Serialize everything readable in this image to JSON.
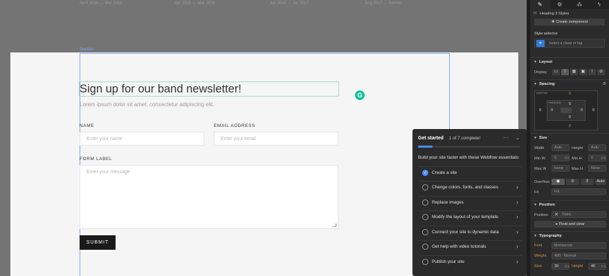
{
  "canvas": {
    "timeline": [
      "April 2014 — Mar 2015",
      "Apr 2015 — Mar 2016",
      "Jun 2016 — Jul 2017",
      "Aug 2017 — forever"
    ],
    "selection_tag": "Section",
    "heading": "Sign up for our band newsletter!",
    "subtitle": "Lorem ipsum dolor sit amet, consectetur adipiscing elit.",
    "form": {
      "name_label": "NAME",
      "name_placeholder": "Enter your name",
      "email_label": "EMAIL ADDRESS",
      "email_placeholder": "Enter your email",
      "message_label": "FORM LABEL",
      "message_placeholder": "Enter your message",
      "submit_label": "SUBMIT"
    },
    "grammarly_glyph": "G"
  },
  "get_started": {
    "title": "Get started",
    "progress_label": "1 of 7 complete!",
    "progress_fraction": 0.14,
    "more": "···",
    "collapse": "⌄",
    "subtitle": "Build your site faster with these Webflow essentials:",
    "items": [
      {
        "label": "Create a site",
        "done": true
      },
      {
        "label": "Change colors, fonts, and classes",
        "done": false
      },
      {
        "label": "Replace images",
        "done": false
      },
      {
        "label": "Modify the layout of your template",
        "done": false
      },
      {
        "label": "Connect your site to dynamic data",
        "done": false
      },
      {
        "label": "Get help with video tutorials",
        "done": false
      },
      {
        "label": "Publish your site",
        "done": false
      }
    ]
  },
  "panel": {
    "tabs": [
      "paintbrush-icon",
      "gear-icon",
      "interactions-icon",
      "lightning-icon"
    ],
    "element_label": "Heading 3 Styles",
    "create_component": "Create component",
    "style_selector_label": "Style selector",
    "style_selector_placeholder": "Select a class or tag",
    "layout": {
      "title": "Layout",
      "display_label": "Display"
    },
    "spacing": {
      "title": "Spacing",
      "margin_label": "MARGIN",
      "padding_label": "PADDING",
      "margin_top": "0",
      "margin_left": "0",
      "margin_right": "0",
      "margin_bottom": "0",
      "padding_top": "0",
      "padding_left": "0",
      "padding_right": "0",
      "padding_bottom": "0"
    },
    "size": {
      "title": "Size",
      "width_label": "Width",
      "width_value": "Auto",
      "height_label": "Height",
      "height_value": "Auto",
      "min_w_label": "Min W",
      "min_w_value": "0",
      "min_w_unit": "PX",
      "min_h_label": "Min H",
      "min_h_value": "0",
      "min_h_unit": "PX",
      "max_w_label": "Max W",
      "max_w_value": "None",
      "max_h_label": "Max H",
      "max_h_value": "None",
      "overflow_label": "Overflow",
      "overflow_auto": "Auto",
      "fit_label": "Fit",
      "fit_value": "Fill"
    },
    "position": {
      "title": "Position",
      "position_label": "Position",
      "position_value": "Static",
      "float_clear": "Float and clear"
    },
    "typography": {
      "title": "Typography",
      "font_label": "Font",
      "font_value": "Montserrat",
      "weight_label": "Weight",
      "weight_value": "400 - Normal",
      "size_label": "Size",
      "size_value": "30",
      "size_unit": "PX",
      "height_label": "Height",
      "height_value": "46",
      "height_unit": "PX"
    }
  }
}
